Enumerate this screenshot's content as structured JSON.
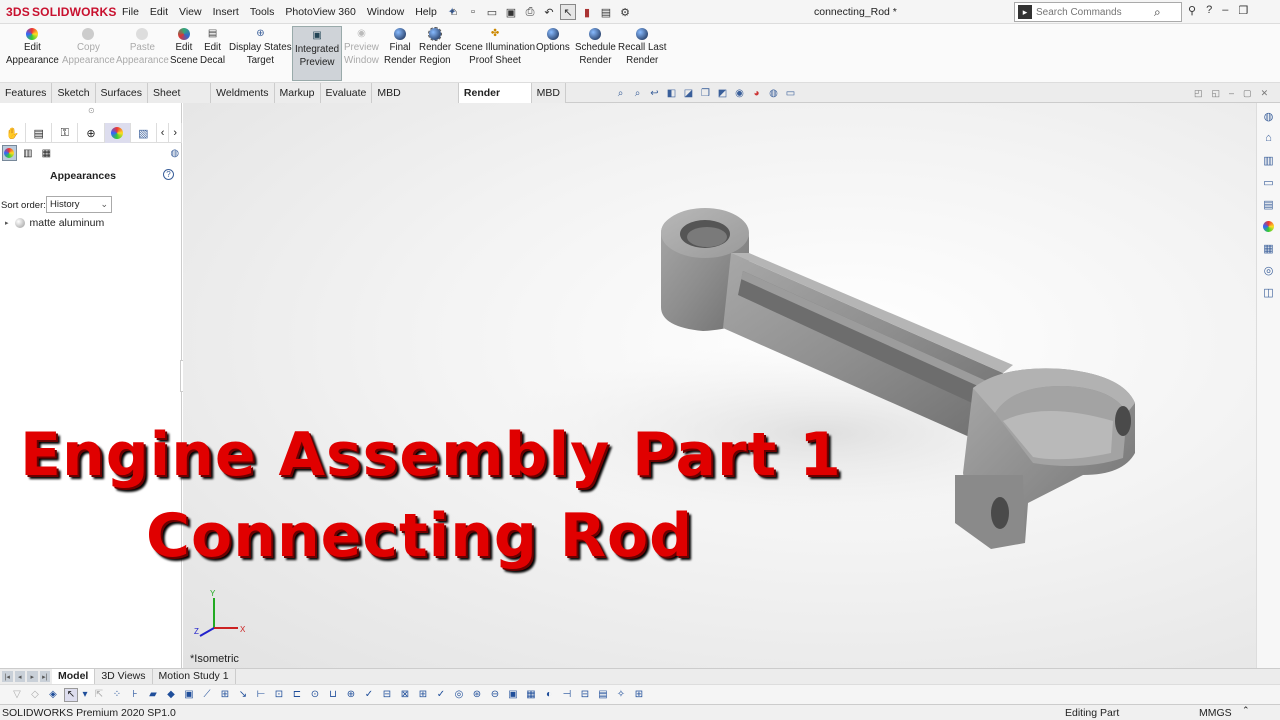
{
  "app": {
    "brand": "SOLIDWORKS",
    "brand_prefix": "3DS",
    "document_title": "connecting_Rod *"
  },
  "menu": [
    "File",
    "Edit",
    "View",
    "Insert",
    "Tools",
    "PhotoView 360",
    "Window",
    "Help"
  ],
  "search": {
    "placeholder": "Search Commands"
  },
  "command_manager": [
    {
      "label1": "Edit",
      "label2": "Appearance",
      "enabled": true,
      "icon": "appearance-icon"
    },
    {
      "label1": "Copy",
      "label2": "Appearance",
      "enabled": false,
      "icon": "copy-appearance-icon"
    },
    {
      "label1": "Paste",
      "label2": "Appearance",
      "enabled": false,
      "icon": "paste-appearance-icon"
    },
    {
      "label1": "Edit",
      "label2": "Scene",
      "enabled": true,
      "icon": "scene-icon"
    },
    {
      "label1": "Edit",
      "label2": "Decal",
      "enabled": true,
      "icon": "decal-icon"
    },
    {
      "label1": "Display States",
      "label2": "Target",
      "enabled": true,
      "icon": "target-icon"
    },
    {
      "label1": "Integrated",
      "label2": "Preview",
      "enabled": true,
      "active": true,
      "icon": "preview-icon"
    },
    {
      "label1": "Preview",
      "label2": "Window",
      "enabled": false,
      "icon": "preview-window-icon"
    },
    {
      "label1": "Final",
      "label2": "Render",
      "enabled": true,
      "icon": "render-icon"
    },
    {
      "label1": "Render",
      "label2": "Region",
      "enabled": true,
      "icon": "render-region-icon"
    },
    {
      "label1": "Scene Illumination",
      "label2": "Proof Sheet",
      "enabled": true,
      "icon": "proof-sheet-icon"
    },
    {
      "label1": "Options",
      "label2": "",
      "enabled": true,
      "icon": "options-icon"
    },
    {
      "label1": "Schedule",
      "label2": "Render",
      "enabled": true,
      "icon": "schedule-icon"
    },
    {
      "label1": "Recall Last",
      "label2": "Render",
      "enabled": true,
      "icon": "recall-icon"
    }
  ],
  "tabs": [
    "Features",
    "Sketch",
    "Surfaces",
    "Sheet Metal",
    "Weldments",
    "Markup",
    "Evaluate",
    "MBD Dimensions",
    "Render Tools",
    "MBD"
  ],
  "selected_tab": "Render Tools",
  "panel": {
    "title": "Appearances",
    "sort_label": "Sort order:",
    "sort_value": "History",
    "tree_item": "matte aluminum"
  },
  "overlay": {
    "line1": "Engine Assembly Part 1",
    "line2": "Connecting Rod"
  },
  "viewport": {
    "view_name": "*Isometric"
  },
  "bottom_tabs": [
    "Model",
    "3D Views",
    "Motion Study 1"
  ],
  "status": {
    "product": "SOLIDWORKS Premium 2020 SP1.0",
    "mode": "Editing Part",
    "units": "MMGS"
  }
}
